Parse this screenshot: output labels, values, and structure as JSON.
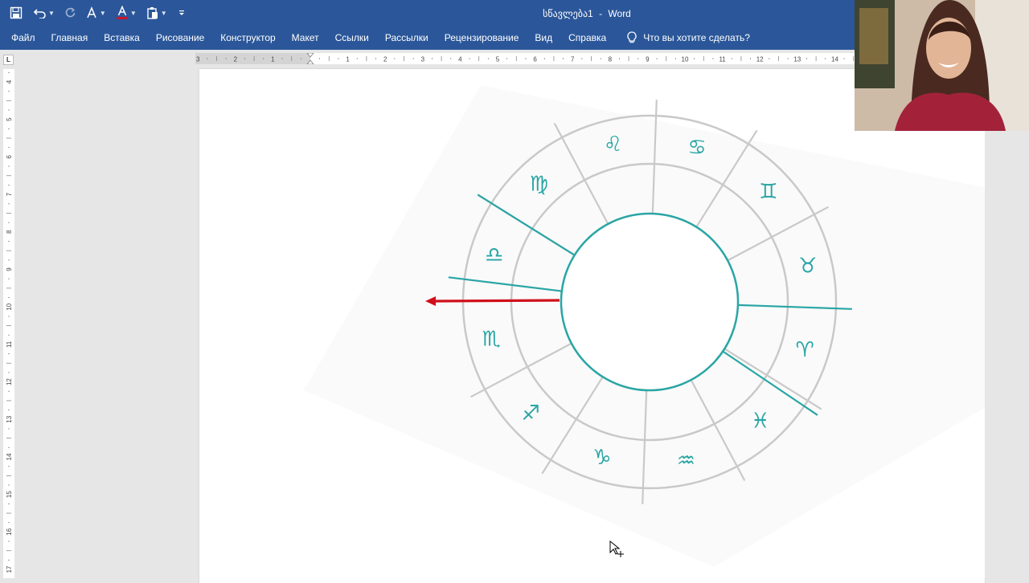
{
  "titlebar": {
    "document_name": "სწავლება1",
    "separator": "-",
    "app_name": "Word",
    "qat": {
      "save_icon": "save-icon",
      "undo_icon": "undo-icon",
      "redo_icon": "redo-icon",
      "format_icon": "text-effects-icon",
      "font_color_icon": "font-color-icon",
      "paste_icon": "paste-icon",
      "customize_icon": "customize-qat-icon"
    }
  },
  "menu": {
    "items": [
      "Файл",
      "Главная",
      "Вставка",
      "Рисование",
      "Конструктор",
      "Макет",
      "Ссылки",
      "Рассылки",
      "Рецензирование",
      "Вид",
      "Справка"
    ],
    "tell_me": "Что вы хотите сделать?"
  },
  "ruler": {
    "corner": "L",
    "h_labels": [
      "3",
      "2",
      "1",
      "1",
      "2",
      "3",
      "4",
      "5",
      "6",
      "7",
      "8",
      "9",
      "10",
      "11",
      "12",
      "13",
      "14"
    ],
    "v_labels": [
      "4",
      "5",
      "6",
      "7",
      "8",
      "9",
      "10",
      "11",
      "12",
      "13",
      "14",
      "15",
      "16",
      "17"
    ]
  },
  "zodiac": {
    "symbols": [
      "♌",
      "♋",
      "♊",
      "♉",
      "♈",
      "♓",
      "♒",
      "♑",
      "♐",
      "♏",
      "♎",
      "♍"
    ],
    "colors": {
      "ring": "#c9c9c9",
      "accent": "#2aa5a5",
      "arrow": "#d0101b"
    }
  },
  "colors": {
    "ribbon": "#2b579a",
    "canvas": "#e6e6e6",
    "page": "#ffffff"
  }
}
